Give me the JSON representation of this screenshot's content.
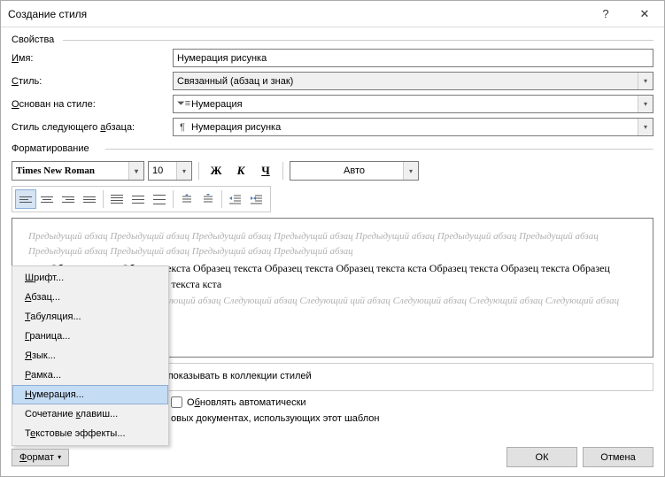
{
  "titlebar": {
    "title": "Создание стиля"
  },
  "props": {
    "group_label": "Свойства",
    "name_label": "Имя:",
    "name_hotkey": "И",
    "name_value": "Нумерация рисунка",
    "style_label": "Стиль:",
    "style_hotkey": "С",
    "style_value": "Связанный (абзац и знак)",
    "based_label": "Основан на стиле:",
    "based_hotkey": "О",
    "based_value": "Нумерация",
    "next_label": "Стиль следующего абзаца:",
    "next_hotkey": "а",
    "next_value": "Нумерация рисунка"
  },
  "fmt": {
    "group_label": "Форматирование",
    "font": "Times New Roman",
    "size": "10",
    "bold": "Ж",
    "italic": "К",
    "underline": "Ч",
    "color": "Авто"
  },
  "preview": {
    "prev": "Предыдущий абзац Предыдущий абзац Предыдущий абзац Предыдущий абзац Предыдущий абзац Предыдущий абзац Предыдущий абзац Предыдущий абзац Предыдущий абзац Предыдущий абзац Предыдущий абзац",
    "sample_suffix": "кста Образец текста Образец текста Образец текста Образец текста Образец текста кста Образец текста Образец текста Образец текста Образец текста Образец текста кста",
    "next_suffix": "ций абзац Следующий абзац Следующий абзац Следующий абзац Следующий ций абзац Следующий абзац Следующий абзац Следующий абзац Следующий абзац"
  },
  "desc": {
    "text_suffix": "у краю,  без нумерации, Стиль: : показывать в коллекции стилей"
  },
  "opts": {
    "auto_update": "Обновлять автоматически",
    "auto_hotkey": "б",
    "templates_suffix": "овых документах, использующих этот шаблон"
  },
  "menu": {
    "items": [
      {
        "label": "Шрифт...",
        "hotkey": "Ш"
      },
      {
        "label": "Абзац...",
        "hotkey": "А"
      },
      {
        "label": "Табуляция...",
        "hotkey": "Т"
      },
      {
        "label": "Граница...",
        "hotkey": "Г"
      },
      {
        "label": "Язык...",
        "hotkey": "Я"
      },
      {
        "label": "Рамка...",
        "hotkey": "Р"
      },
      {
        "label": "Нумерация...",
        "hotkey": "Н"
      },
      {
        "label": "Сочетание клавиш...",
        "hotkey": "к"
      },
      {
        "label": "Текстовые эффекты...",
        "hotkey": "е"
      }
    ],
    "hover_index": 6
  },
  "footer": {
    "format": "Формат",
    "format_hotkey": "Ф",
    "ok": "ОК",
    "cancel": "Отмена"
  }
}
